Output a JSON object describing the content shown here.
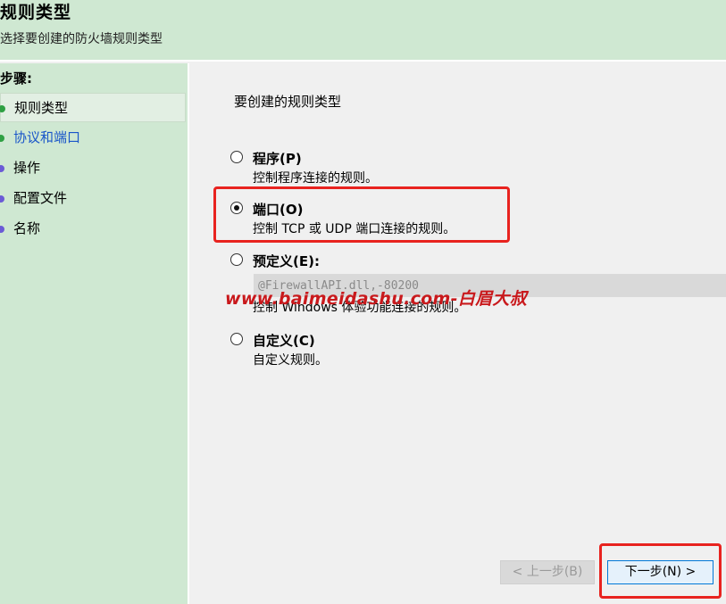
{
  "header": {
    "title": "规则类型",
    "subtitle": "选择要创建的防火墙规则类型"
  },
  "sidebar": {
    "steps_title": "步骤:",
    "items": [
      {
        "label": "规则类型",
        "dot_color": "#2ea043",
        "state": "current"
      },
      {
        "label": "协议和端口",
        "dot_color": "#2ea043",
        "state": "link"
      },
      {
        "label": "操作",
        "dot_color": "#6b5bd6",
        "state": "normal"
      },
      {
        "label": "配置文件",
        "dot_color": "#6b5bd6",
        "state": "normal"
      },
      {
        "label": "名称",
        "dot_color": "#6b5bd6",
        "state": "normal"
      }
    ]
  },
  "main": {
    "prompt": "要创建的规则类型",
    "options": [
      {
        "label": "程序(P)",
        "desc": "控制程序连接的规则。",
        "checked": false
      },
      {
        "label": "端口(O)",
        "desc": "控制 TCP 或 UDP 端口连接的规则。",
        "checked": true
      },
      {
        "label": "预定义(E):",
        "desc": "控制 Windows 体验功能连接的规则。",
        "checked": false
      },
      {
        "label": "自定义(C)",
        "desc": "自定义规则。",
        "checked": false
      }
    ],
    "predefined_field_value": "@FirewallAPI.dll,-80200"
  },
  "watermark": "www.baimeidashu.com-白眉大叔",
  "buttons": {
    "back": "< 上一步(B)",
    "next": "下一步(N) >"
  },
  "colors": {
    "header_bg": "#cfe8d2",
    "highlight_red": "#e8231f",
    "link_blue": "#1a56c9"
  }
}
